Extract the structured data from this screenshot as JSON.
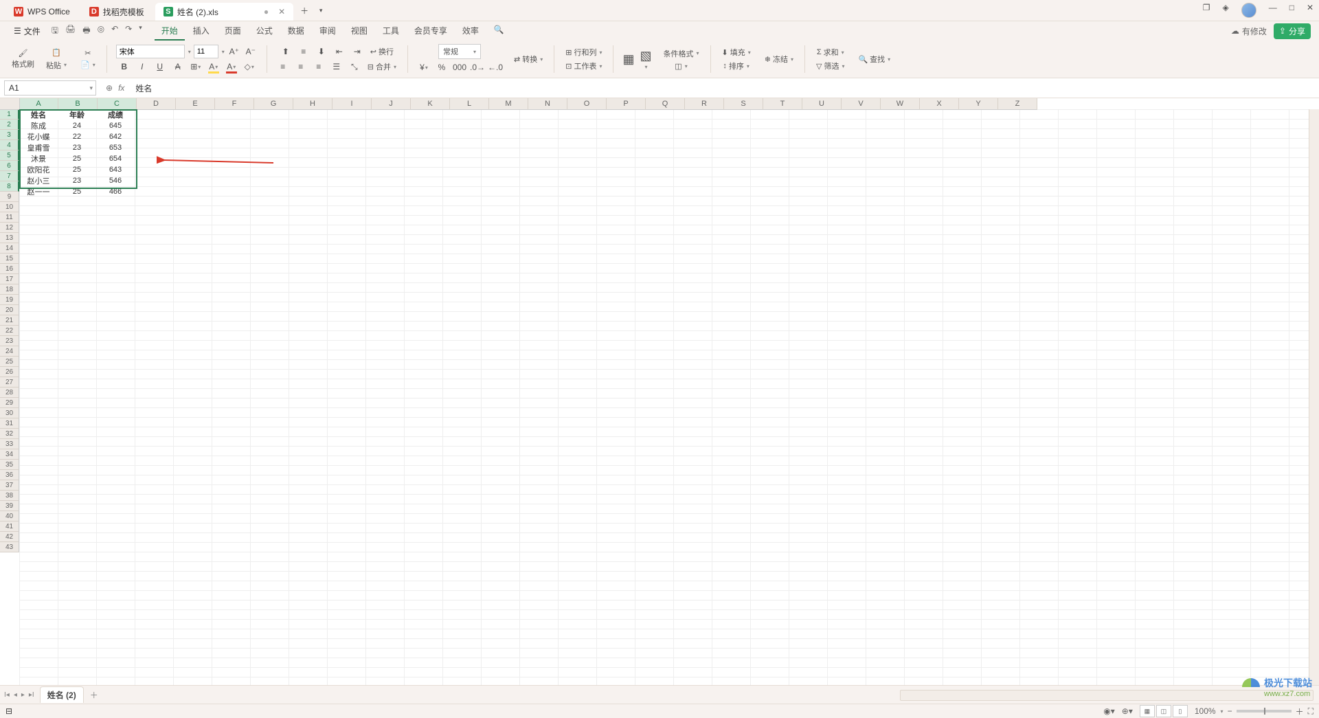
{
  "tabs": [
    {
      "icon_bg": "#d93a2b",
      "icon_fg": "#fff",
      "icon_txt": "W",
      "label": "WPS Office",
      "active": false
    },
    {
      "icon_bg": "#d93a2b",
      "icon_fg": "#fff",
      "icon_txt": "D",
      "label": "找稻壳模板",
      "active": false
    },
    {
      "icon_bg": "#2a9d5e",
      "icon_fg": "#fff",
      "icon_txt": "S",
      "label": "姓名 (2).xls",
      "active": true,
      "dirty": "●"
    }
  ],
  "file_menu": "文件",
  "menus": [
    "开始",
    "插入",
    "页面",
    "公式",
    "数据",
    "审阅",
    "视图",
    "工具",
    "会员专享",
    "效率"
  ],
  "active_menu": 0,
  "right_status": {
    "modify": "有修改",
    "share": "分享"
  },
  "ribbon": {
    "format_painter": "格式刷",
    "paste": "粘贴",
    "cut_icon": "剪切",
    "font_name": "宋体",
    "font_size": "11",
    "wrap": "换行",
    "merge": "合并",
    "general": "常规",
    "convert": "转换",
    "rowcol": "行和列",
    "worksheet": "工作表",
    "cond_fmt": "条件格式",
    "fill": "填充",
    "sort": "排序",
    "freeze": "冻结",
    "sum": "求和",
    "filter": "筛选",
    "find": "查找"
  },
  "namebox": "A1",
  "formula_value": "姓名",
  "columns": [
    "A",
    "B",
    "C",
    "D",
    "E",
    "F",
    "G",
    "H",
    "I",
    "J",
    "K",
    "L",
    "M",
    "N",
    "O",
    "P",
    "Q",
    "R",
    "S",
    "T",
    "U",
    "V",
    "W",
    "X",
    "Y",
    "Z"
  ],
  "selected_cols": 3,
  "row_count": 43,
  "selected_rows": 8,
  "table": {
    "headers": [
      "姓名",
      "年龄",
      "成绩"
    ],
    "rows": [
      [
        "陈成",
        "24",
        "645"
      ],
      [
        "花小蝶",
        "22",
        "642"
      ],
      [
        "皇甫雪",
        "23",
        "653"
      ],
      [
        "沐景",
        "25",
        "654"
      ],
      [
        "欧阳花",
        "25",
        "643"
      ],
      [
        "赵小三",
        "23",
        "546"
      ],
      [
        "赵一一",
        "25",
        "466"
      ]
    ]
  },
  "sheet_tab": "姓名 (2)",
  "zoom": "100%",
  "watermark": {
    "brand": "极光下载站",
    "url": "www.xz7.com"
  }
}
